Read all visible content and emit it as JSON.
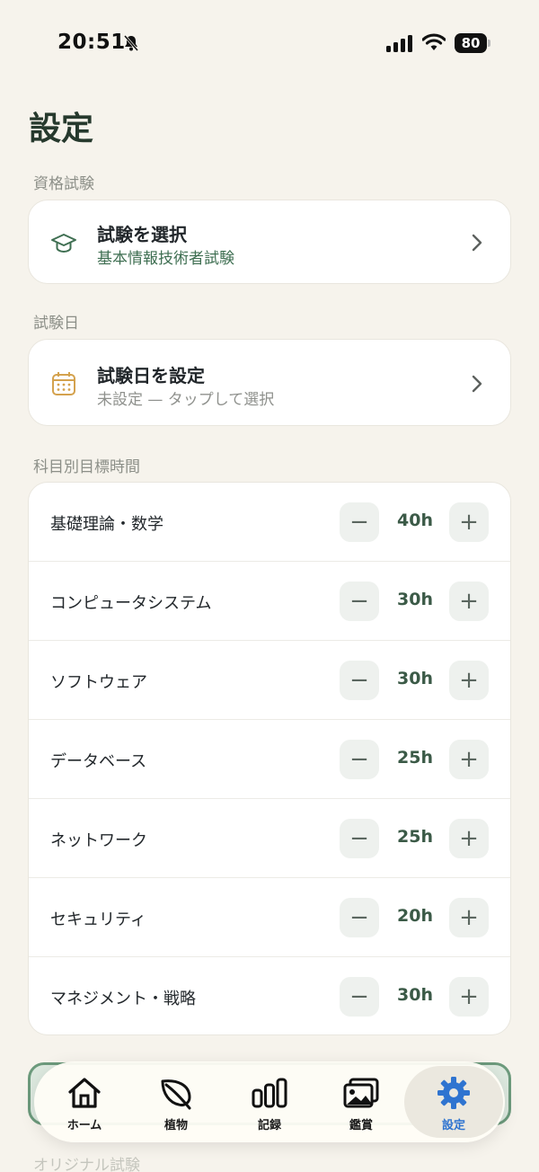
{
  "status_bar": {
    "time": "20:51",
    "battery": "80"
  },
  "page": {
    "title": "設定"
  },
  "exam_section": {
    "label": "資格試験",
    "title": "試験を選択",
    "subtitle": "基本情報技術者試験",
    "icon": "graduation-cap-icon",
    "subtitle_color": "#3f6f52"
  },
  "date_section": {
    "label": "試験日",
    "title": "試験日を設定",
    "subtitle": "未設定 — タップして選択",
    "icon": "calendar-icon",
    "subtitle_color": "#8f918d"
  },
  "goals_section": {
    "label": "科目別目標時間",
    "minus": "−",
    "plus": "+",
    "items": [
      {
        "name": "基礎理論・数学",
        "value": "40h"
      },
      {
        "name": "コンピュータシステム",
        "value": "30h"
      },
      {
        "name": "ソフトウェア",
        "value": "30h"
      },
      {
        "name": "データベース",
        "value": "25h"
      },
      {
        "name": "ネットワーク",
        "value": "25h"
      },
      {
        "name": "セキュリティ",
        "value": "20h"
      },
      {
        "name": "マネジメント・戦略",
        "value": "30h"
      }
    ]
  },
  "partial": {
    "label": "オリジナル試験"
  },
  "tabs": [
    {
      "label": "ホーム",
      "icon": "house-icon"
    },
    {
      "label": "植物",
      "icon": "leaf-icon"
    },
    {
      "label": "記録",
      "icon": "bar-chart-icon"
    },
    {
      "label": "鑑賞",
      "icon": "gallery-icon"
    },
    {
      "label": "設定",
      "icon": "gear-icon",
      "active": true
    }
  ],
  "colors": {
    "accent": "#2f74d0",
    "brand_green": "#3b5a47",
    "background": "#f6f3ec"
  }
}
